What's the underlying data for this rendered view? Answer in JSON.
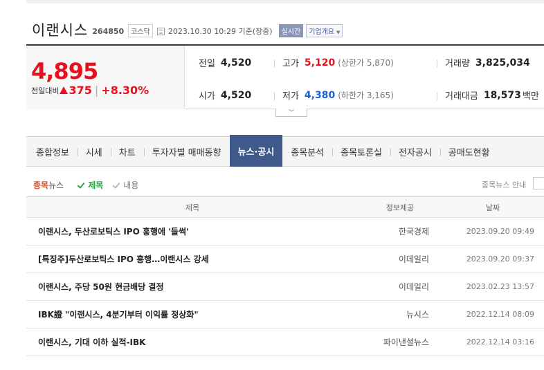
{
  "stock": {
    "name": "이랜시스",
    "code": "264850",
    "market": "코스닥",
    "datetime": "2023.10.30 10:29 기준(장중)",
    "live_label": "실시간",
    "company_info_label": "기업개요"
  },
  "price": {
    "current": "4,895",
    "change_label": "전일대비",
    "change": "375",
    "change_pct": "+8.30%",
    "direction": "up",
    "up_color": "#e8101c",
    "down_color": "#1763d9"
  },
  "stats": {
    "prev_close": {
      "label": "전일",
      "value": "4,520"
    },
    "open": {
      "label": "시가",
      "value": "4,520"
    },
    "high": {
      "label": "고가",
      "value": "5,120",
      "upper_limit_label": "(상한가 5,870)"
    },
    "low": {
      "label": "저가",
      "value": "4,380",
      "lower_limit_label": "(하한가 3,165)"
    },
    "volume": {
      "label": "거래량",
      "value": "3,825,034"
    },
    "amount": {
      "label": "거래대금",
      "value": "18,573",
      "unit": "백만"
    }
  },
  "tabs": [
    {
      "label": "종합정보",
      "active": false
    },
    {
      "label": "시세",
      "active": false
    },
    {
      "label": "차트",
      "active": false
    },
    {
      "label": "투자자별 매매동향",
      "active": false
    },
    {
      "label": "뉴스·공시",
      "active": true
    },
    {
      "label": "종목분석",
      "active": false
    },
    {
      "label": "종목토론실",
      "active": false
    },
    {
      "label": "전자공시",
      "active": false
    },
    {
      "label": "공매도현황",
      "active": false
    }
  ],
  "tab_active_color": "#3f5a8a",
  "filter": {
    "section_prefix": "종목",
    "section_suffix": "뉴스",
    "title_option": "제목",
    "content_option": "내용",
    "guide": "종목뉴스 안내"
  },
  "news_table": {
    "headers": {
      "title": "제목",
      "source": "정보제공",
      "date": "날짜"
    },
    "rows": [
      {
        "title": "이랜시스, 두산로보틱스 IPO 흥행에 '들썩'",
        "source": "한국경제",
        "date": "2023.09.20 09:49"
      },
      {
        "title": "[특징주]두산로보틱스 IPO 흥행…이랜시스 강세",
        "source": "이데일리",
        "date": "2023.09.20 09:37"
      },
      {
        "title": "이랜시스, 주당 50원 현금배당 결정",
        "source": "이데일리",
        "date": "2023.02.23 13:57"
      },
      {
        "title": "IBK證 \"이랜시스, 4분기부터 이익률 정상화\"",
        "source": "뉴시스",
        "date": "2022.12.14 08:09"
      },
      {
        "title": "이랜시스, 기대 이하 실적-IBK",
        "source": "파이낸셜뉴스",
        "date": "2022.12.14 03:16"
      }
    ]
  }
}
